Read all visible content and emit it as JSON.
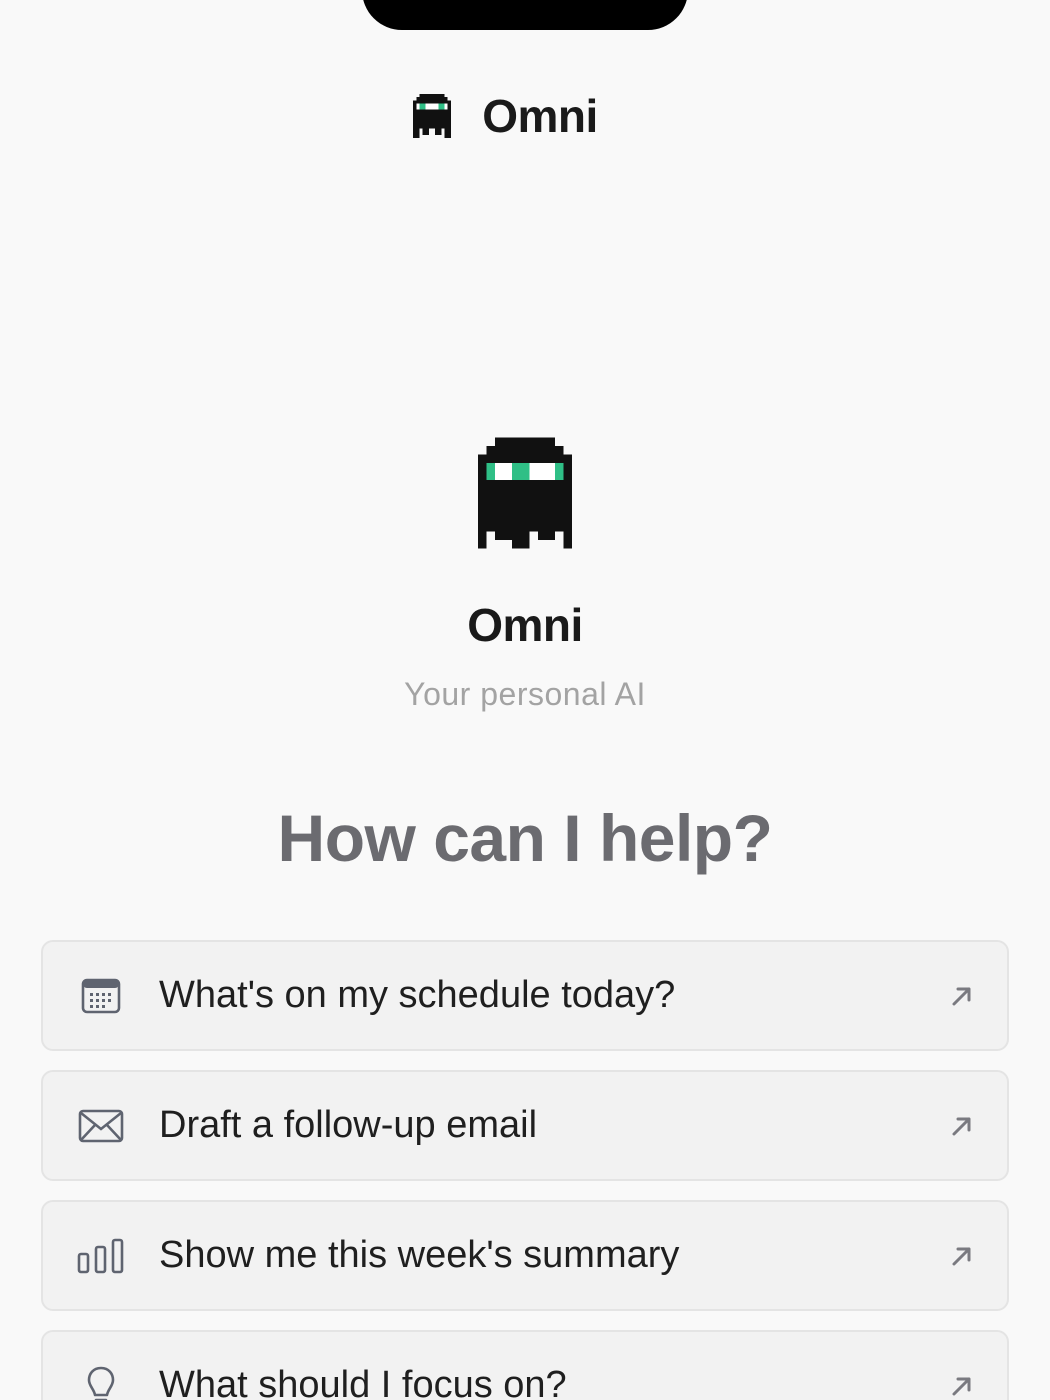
{
  "header": {
    "title": "Omni",
    "logo_icon": "ghost-logo-icon"
  },
  "hero": {
    "name": "Omni",
    "subtitle": "Your personal AI",
    "logo_icon": "ghost-logo-icon"
  },
  "prompt": {
    "title": "How can I help?"
  },
  "suggestions": [
    {
      "label": "What's on my schedule today?",
      "icon": "calendar-icon"
    },
    {
      "label": "Draft a follow-up email",
      "icon": "envelope-icon"
    },
    {
      "label": "Show me this week's summary",
      "icon": "bar-chart-icon"
    },
    {
      "label": "What should I focus on?",
      "icon": "lightbulb-icon"
    }
  ],
  "colors": {
    "background": "#f9f9f9",
    "accent_eyes": "#2fbf86",
    "card_bg": "#f2f2f2",
    "muted_text": "#a3a3a3",
    "heading_gray": "#6b6b70"
  }
}
